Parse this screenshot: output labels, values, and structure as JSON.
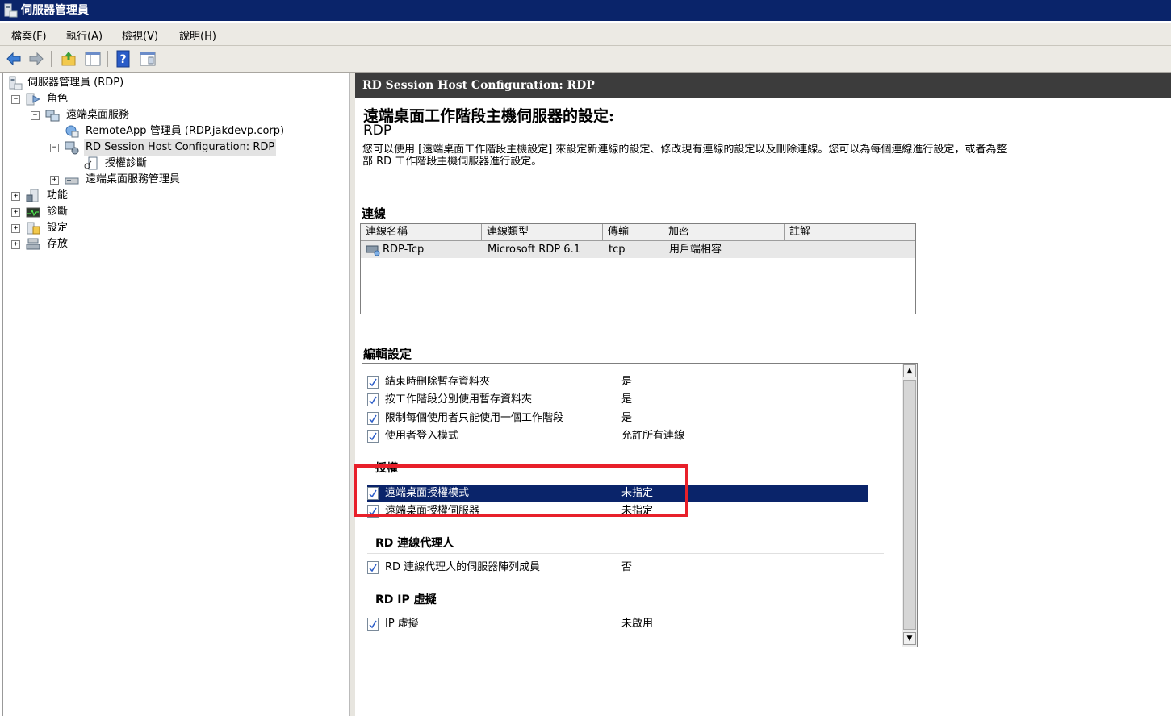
{
  "window": {
    "title": "伺服器管理員"
  },
  "menu": [
    "檔案(F)",
    "執行(A)",
    "檢視(V)",
    "說明(H)"
  ],
  "toolbar": {
    "icons": [
      "back-arrow-icon",
      "forward-arrow-icon",
      "up-folder-icon",
      "show-hide-console-tree-icon",
      "help-icon",
      "properties-icon"
    ]
  },
  "tree": {
    "root": "伺服器管理員 (RDP)",
    "roles": "角色",
    "rds": "遠端桌面服務",
    "remoteapp": "RemoteApp 管理員 (RDP.jakdevp.corp)",
    "rdsh": "RD Session Host Configuration: RDP",
    "lic_diag": "授權診斷",
    "rds_manager": "遠端桌面服務管理員",
    "features": "功能",
    "diagnostics": "診斷",
    "config": "設定",
    "storage": "存放"
  },
  "right": {
    "header": "RD Session Host Configuration: RDP",
    "title": "遠端桌面工作階段主機伺服器的設定:",
    "server": "RDP",
    "description": "您可以使用 [遠端桌面工作階段主機設定] 來設定新連線的設定、修改現有連線的設定以及刪除連線。您可以為每個連線進行設定，或者為整部 RD 工作階段主機伺服器進行設定。",
    "connections_heading": "連線",
    "connections": {
      "columns": [
        "連線名稱",
        "連線類型",
        "傳輸",
        "加密",
        "註解"
      ],
      "rows": [
        {
          "name": "RDP-Tcp",
          "type": "Microsoft RDP 6.1",
          "transport": "tcp",
          "encryption": "用戶端相容",
          "comment": ""
        }
      ]
    },
    "edit_heading": "編輯設定",
    "edit": {
      "general": [
        {
          "label": "結束時刪除暫存資料夾",
          "value": "是"
        },
        {
          "label": "按工作階段分別使用暫存資料夾",
          "value": "是"
        },
        {
          "label": "限制每個使用者只能使用一個工作階段",
          "value": "是"
        },
        {
          "label": "使用者登入模式",
          "value": "允許所有連線"
        }
      ],
      "licensing_group": "授權",
      "licensing": [
        {
          "label": "遠端桌面授權模式",
          "value": "未指定"
        },
        {
          "label": "遠端桌面授權伺服器",
          "value": "未指定"
        }
      ],
      "broker_group": "RD 連線代理人",
      "broker": [
        {
          "label": "RD 連線代理人的伺服器陣列成員",
          "value": "否"
        }
      ],
      "ipv_group": "RD IP 虛擬",
      "ipv": [
        {
          "label": "IP 虛擬",
          "value": "未啟用"
        }
      ]
    }
  },
  "colors": {
    "titlebar": "#0a246a",
    "selection": "#0a246a",
    "annotation_box": "#e8202a",
    "pane_header": "#3c3c3c"
  }
}
